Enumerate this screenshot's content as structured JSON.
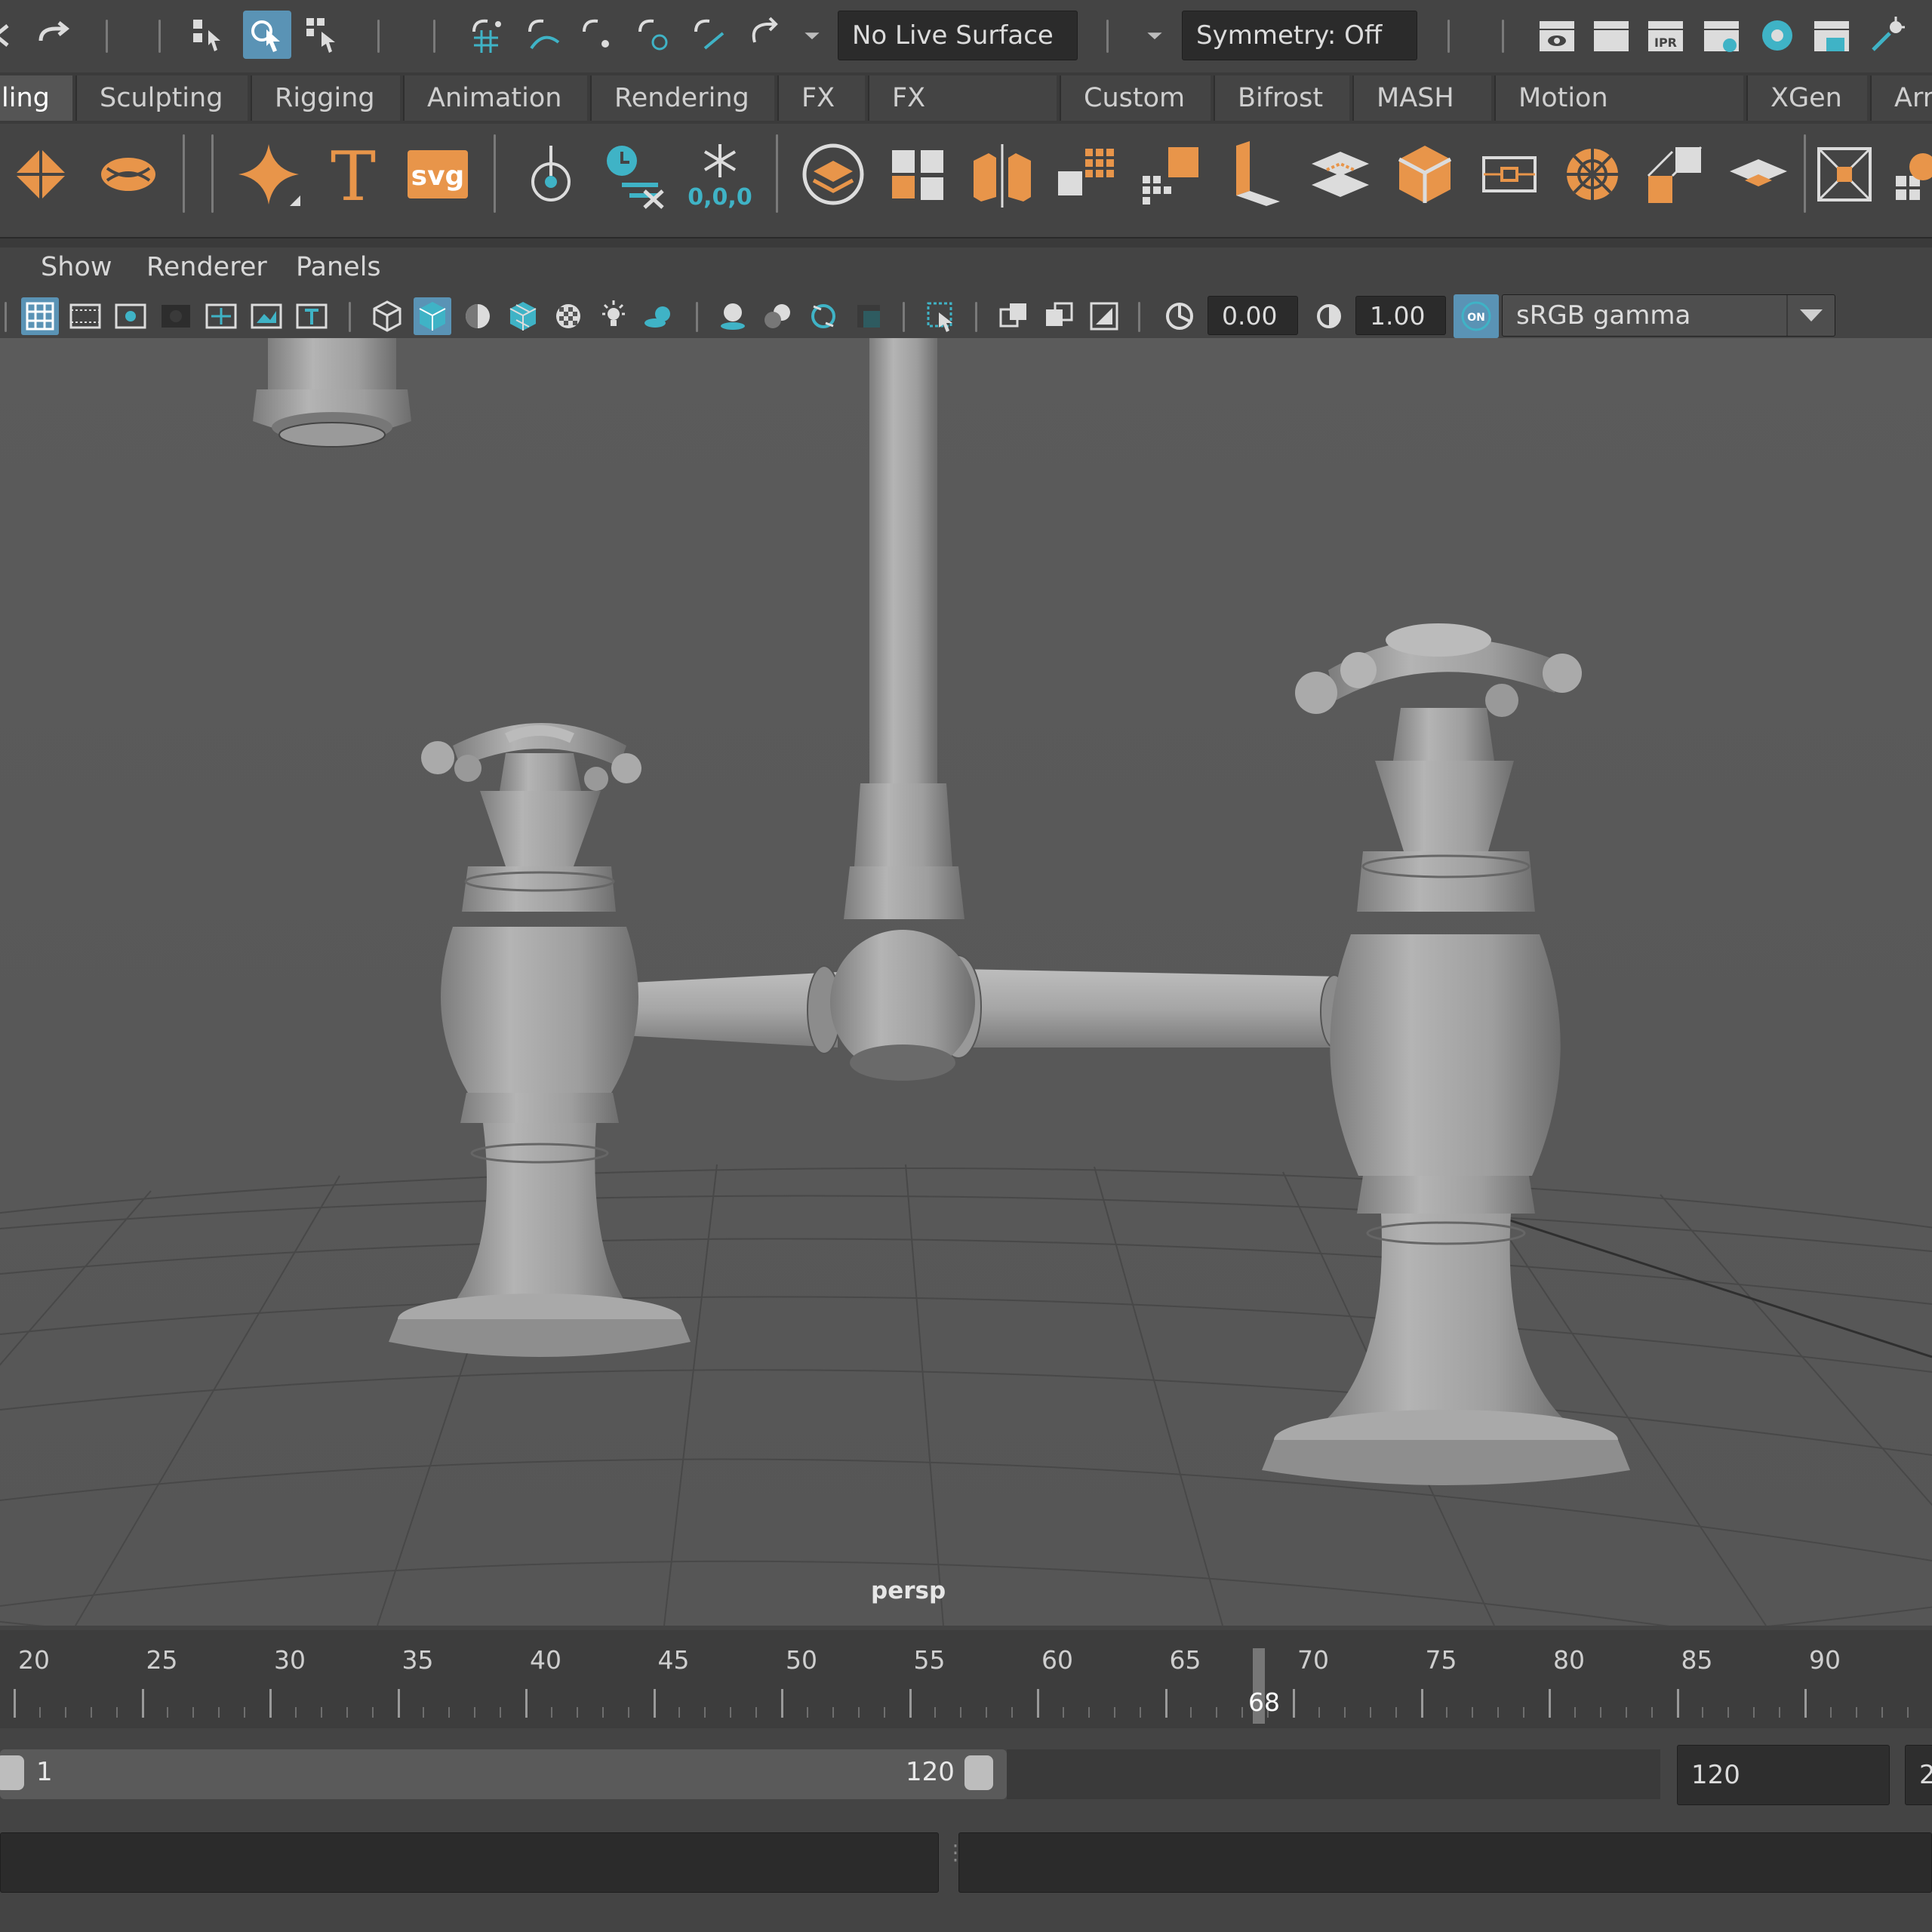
{
  "status_line": {
    "live_surface": "No Live Surface",
    "symmetry": "Symmetry: Off"
  },
  "shelf_tabs": [
    "ling",
    "Sculpting",
    "Rigging",
    "Animation",
    "Rendering",
    "FX",
    "FX Caching",
    "Custom",
    "Bifrost",
    "MASH",
    "Motion Graphics",
    "XGen",
    "Arr"
  ],
  "shelf": {
    "svg_label": "svg",
    "text_label": "T",
    "origin_label": "0,0,0"
  },
  "panel_menu": [
    "Show",
    "Renderer",
    "Panels"
  ],
  "panel_toolbar": {
    "exposure": "0.00",
    "gamma": "1.00",
    "color_mgmt_badge": "ON",
    "color_space": "sRGB gamma"
  },
  "viewport": {
    "camera": "persp"
  },
  "timeline": {
    "ticks": [
      "20",
      "25",
      "30",
      "35",
      "40",
      "45",
      "50",
      "55",
      "60",
      "65",
      "70",
      "75",
      "80",
      "85",
      "90"
    ],
    "current_frame": "68"
  },
  "range": {
    "start": "1",
    "end": "120",
    "anim_end": "120",
    "partial": "2"
  },
  "colors": {
    "accent_blue": "#5a93b5",
    "shelf_orange": "#e8954a",
    "teal": "#3fb3c6"
  }
}
